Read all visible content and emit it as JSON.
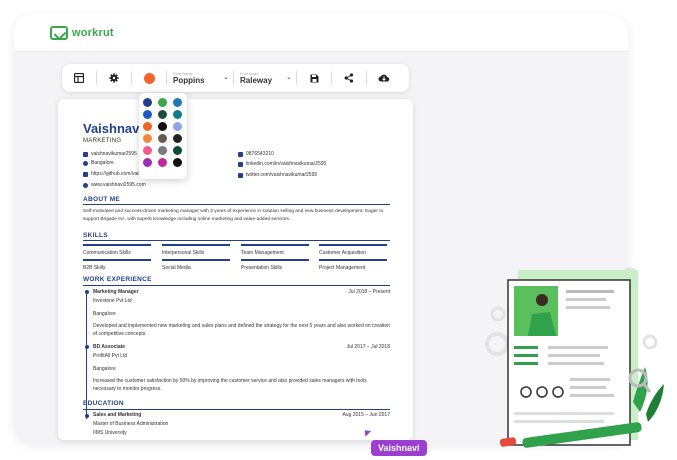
{
  "brand": {
    "name": "workrut",
    "color": "#3aa84a"
  },
  "toolbar": {
    "layout_icon": "layout-icon",
    "settings_icon": "gear-icon",
    "font1": {
      "label": "Font Name",
      "value": "Poppins"
    },
    "font2": {
      "label": "Font Body",
      "value": "Raleway"
    },
    "save_icon": "save-icon",
    "share_icon": "share-icon",
    "download_icon": "cloud-download-icon",
    "accent_color": "#f06529"
  },
  "palette": [
    "#23408e",
    "#3aa84a",
    "#1f77b4",
    "#1e5bc6",
    "#1f4d3a",
    "#147a8a",
    "#f06529",
    "#111111",
    "#8aa8e8",
    "#f28a3d",
    "#6b5b4b",
    "#222222",
    "#f25c8c",
    "#7a7a7a",
    "#0c4a3a",
    "#9b2fb5",
    "#c0289a",
    "#111111"
  ],
  "resume": {
    "name": "Vaishnavi K",
    "role": "MARKETING",
    "contacts_left": [
      "vaishnavikumar2595",
      "Bangalore",
      "https://github.com/vaishnavikumar2595",
      "www.vaishnavi2595.com"
    ],
    "contacts_right": [
      "9876543210",
      "linkedin.com/in/vaishnavikumar2595",
      "twitter.com/vaishnavikumar2595"
    ],
    "about_title": "ABOUT ME",
    "about_text": "Self-motivated and success-driven marketing manager with 3 years of experience in solution selling and new business development. Eager to support Brigade Inc. with superb knowledge including online marketing and value-added services.",
    "skills_title": "SKILLS",
    "skills": [
      "Communication Skills",
      "Interpersonal Skills",
      "Team Management",
      "Customer Acquisition",
      "B2B Skills",
      "Social Media",
      "Presentation Skills",
      "Project Management"
    ],
    "work_title": "WORK EXPERIENCE",
    "jobs": [
      {
        "title": "Marketing Manager",
        "dates": "Jul 2018  –  Present",
        "company": "Investone Pvt Ltd",
        "location": "Bangalore",
        "desc": "Developed and implemented new marketing and sales plans and defined the strategy for the next 5 years and also worked on creation of competitive concepts."
      },
      {
        "title": "BD Associate",
        "dates": "Jul 2017  –  Jul 2018",
        "company": "ProfitAll Pvt Ltd",
        "location": "Bangalore",
        "desc": "Increased the customer satisfaction by 50% by improving the customer service and also provided sales managers with tools necessary to monitor progress."
      }
    ],
    "education_title": "EDUCATION",
    "education": [
      {
        "title": "Sales and Marketing",
        "dates": "Aug 2015  –  Jun 2017",
        "degree": "Master of Business Administration",
        "school": "IIMS University"
      }
    ]
  },
  "cursor_label": "Vaishnavi"
}
